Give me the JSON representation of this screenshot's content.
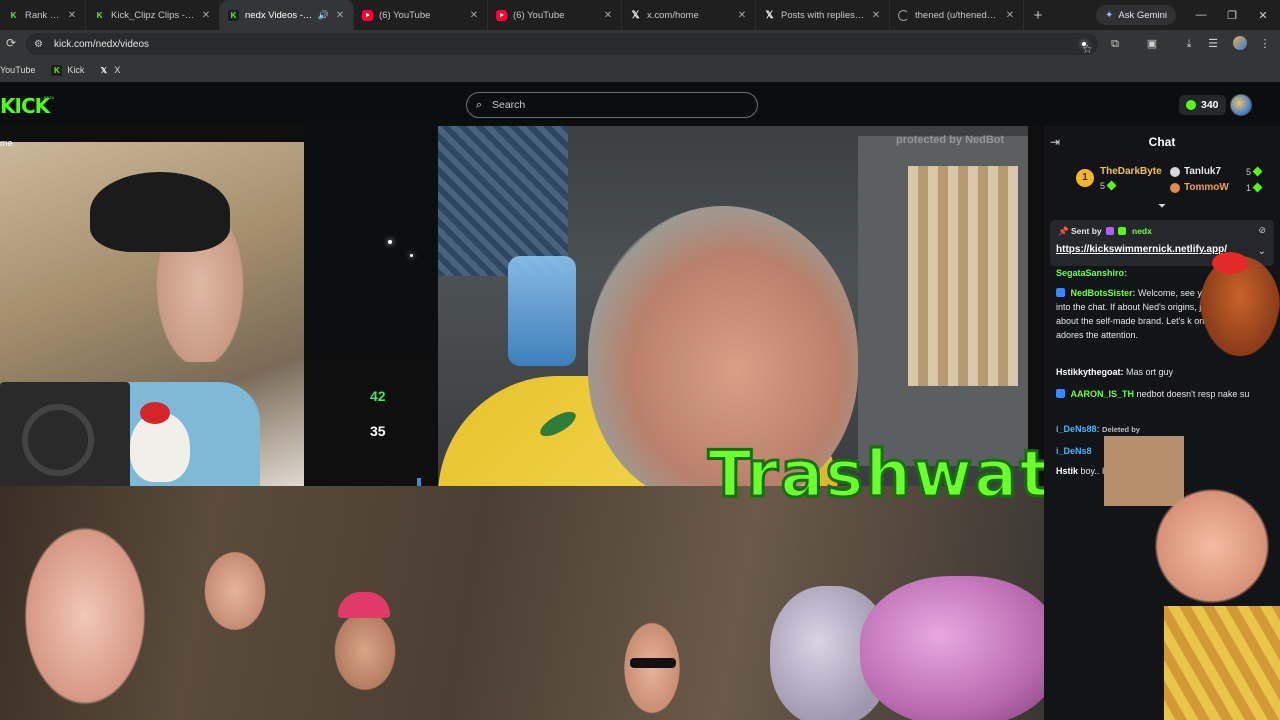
{
  "browser": {
    "tabs": [
      {
        "label": "Rank Clips - Wa",
        "icon": "kick-favicon",
        "active": false
      },
      {
        "label": "Kick_Clipz Clips - Watch",
        "icon": "kick-favicon",
        "active": false
      },
      {
        "label": "nedx Videos - Wate",
        "icon": "kick-favicon",
        "active": true
      },
      {
        "label": "(6) YouTube",
        "icon": "youtube-favicon",
        "active": false
      },
      {
        "label": "(6) YouTube",
        "icon": "youtube-favicon",
        "active": false
      },
      {
        "label": "x.com/home",
        "icon": "x-favicon",
        "active": false
      },
      {
        "label": "Posts with replies by Tr",
        "icon": "x-favicon",
        "active": false
      },
      {
        "label": "thened (u/thened) - Re",
        "icon": "loading-spinner",
        "active": false
      }
    ],
    "gemini_label": "Ask Gemini",
    "url": "kick.com/nedx/videos",
    "bookmarks": [
      {
        "label": "YouTube",
        "icon": "youtube-favicon"
      },
      {
        "label": "Kick",
        "icon": "kick-favicon"
      },
      {
        "label": "X",
        "icon": "x-favicon"
      }
    ]
  },
  "kick": {
    "logo_text": "KICK",
    "beta_tag": "BETA",
    "search_placeholder": "Search",
    "points": "340",
    "home_label": "me",
    "accent_color": "#53fc18"
  },
  "video": {
    "watermark": "protected by NedBot",
    "overlay_metric_green": "42",
    "overlay_metric_white": "35",
    "title_text": "Trashwatch"
  },
  "chat": {
    "title": "Chat",
    "leaderboard": [
      {
        "rank": "1",
        "name": "TheDarkByte",
        "count": "5"
      },
      {
        "name": "Tanluk7",
        "count": "5"
      },
      {
        "name": "TommoW",
        "count": "1"
      }
    ],
    "pinned": {
      "sent_by_label": "Sent by",
      "user": "nedx",
      "link": "https://kickswimmernick.netlify.app/"
    },
    "messages": [
      {
        "user": "SegataSanshiro:",
        "user_color": "#6dff42",
        "text": ""
      },
      {
        "user": "NedBotsSister:",
        "user_color": "#6dff42",
        "text": "Welcome, see you're diving into the chat. If about Ned's origins, just remembe about the self-made brand. Let's k on him—he adores the attention."
      },
      {
        "user": "Hstikkythegoat:",
        "user_color": "#ffffff",
        "text": "Mas ort guy"
      },
      {
        "user": "AARON_IS_TH",
        "user_color": "#6dff42",
        "text": "nedbot doesn't resp nake su"
      },
      {
        "user": "i_DeNs88:",
        "user_color": "#3fb7ff",
        "text": "Deleted by"
      },
      {
        "user": "i_DeNs8",
        "user_color": "#3fb7ff",
        "text": ""
      },
      {
        "user": "Hstik",
        "user_color": "#ffffff",
        "text": "boy.. I anoth"
      }
    ]
  }
}
